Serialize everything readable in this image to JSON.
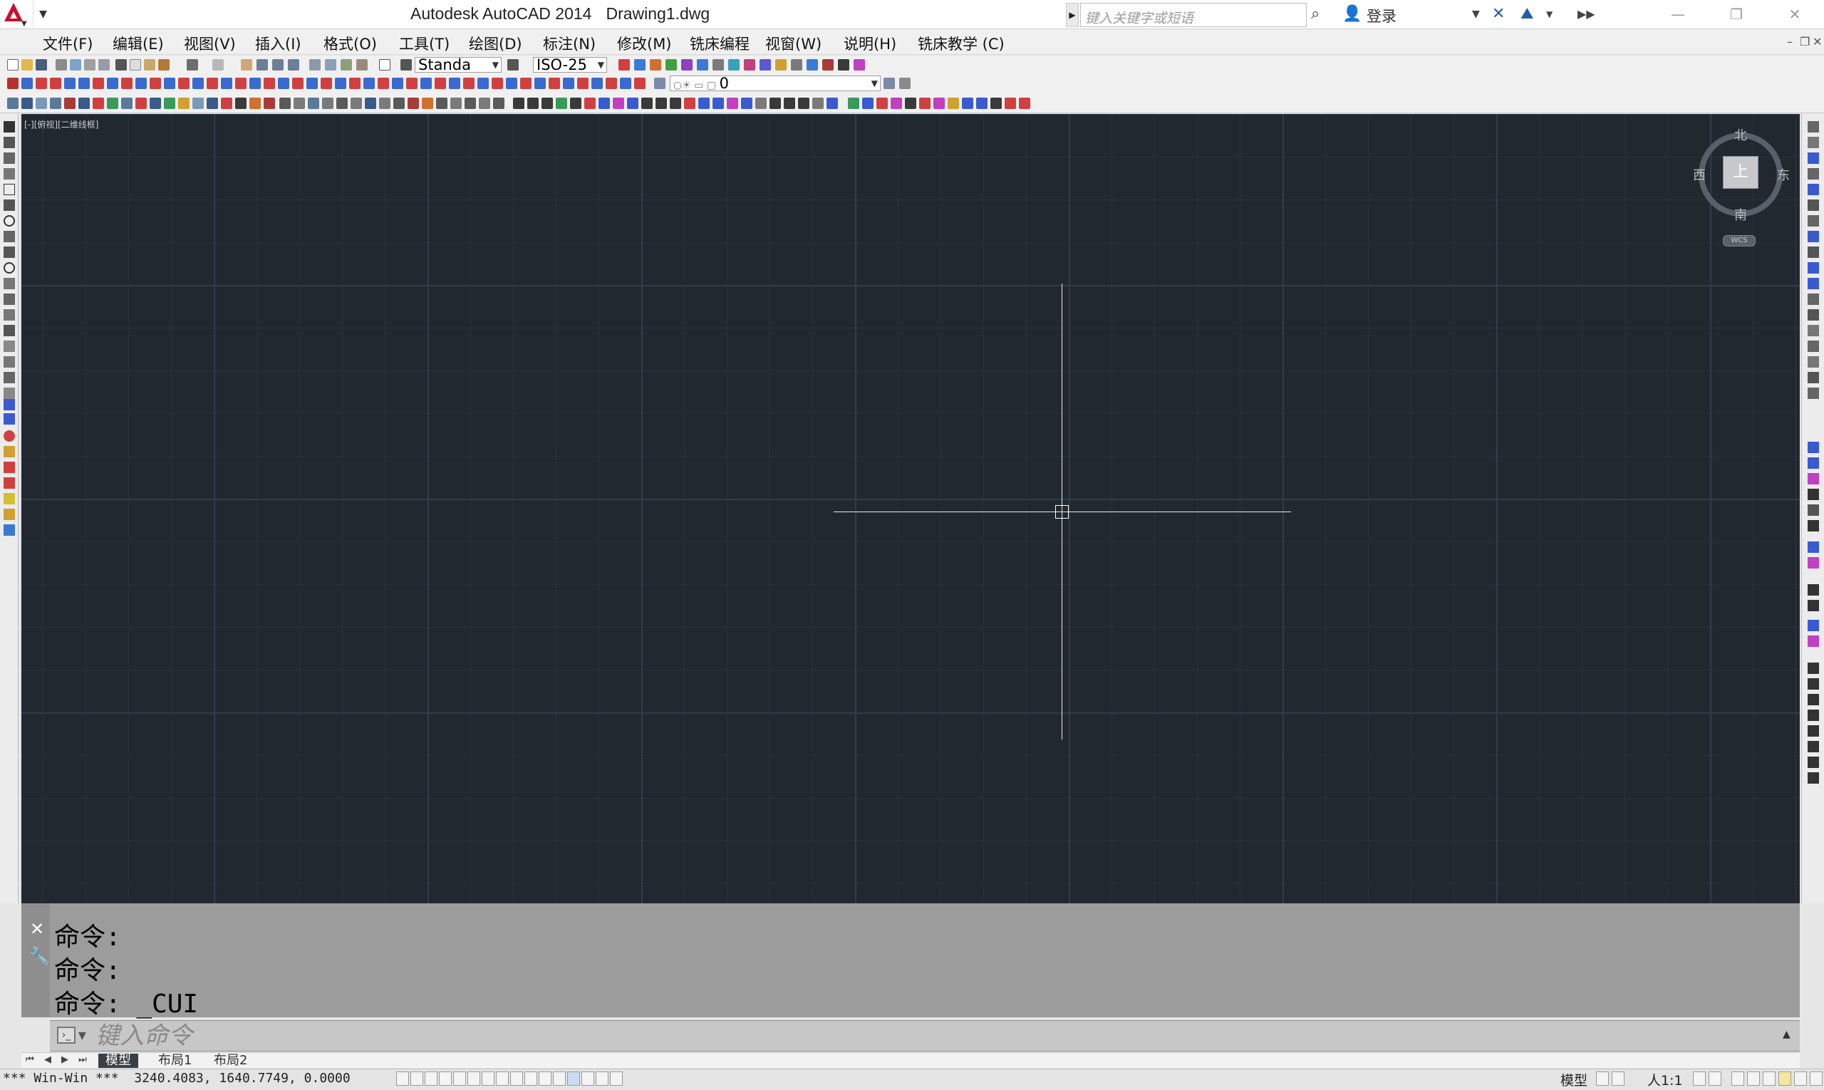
{
  "titlebar": {
    "app_name": "Autodesk AutoCAD 2014",
    "document": "Drawing1.dwg",
    "search_placeholder": "键入关键字或短语",
    "login_label": "登录"
  },
  "menu": {
    "items": [
      "文件(F)",
      "编辑(E)",
      "视图(V)",
      "插入(I)",
      "格式(O)",
      "工具(T)",
      "绘图(D)",
      "标注(N)",
      "修改(M)",
      "铣床编程",
      "视窗(W)",
      "说明(H)",
      "铣床教学 (C)"
    ]
  },
  "toolbar": {
    "text_style": "Standa",
    "dim_style": "ISO-25",
    "layer": "0"
  },
  "viewport": {
    "label": "[-][俯视][二维线框]"
  },
  "viewcube": {
    "north": "北",
    "south": "南",
    "east": "东",
    "west": "西",
    "top_face": "上",
    "wcs": "WCS"
  },
  "command": {
    "history": [
      "命令:",
      "命令:",
      "命令: _CUI"
    ],
    "placeholder": "键入命令"
  },
  "layout_tabs": [
    "模型",
    "布局1",
    "布局2"
  ],
  "statusbar": {
    "coordinates": "*** Win-Win ***  3240.4083, 1640.7749, 0.0000",
    "model_label": "模型",
    "scale_label": "人1:1"
  },
  "colors": {
    "canvas_bg": "#212830",
    "brand_red": "#c8102e",
    "command_bg": "#9c9c9c"
  }
}
